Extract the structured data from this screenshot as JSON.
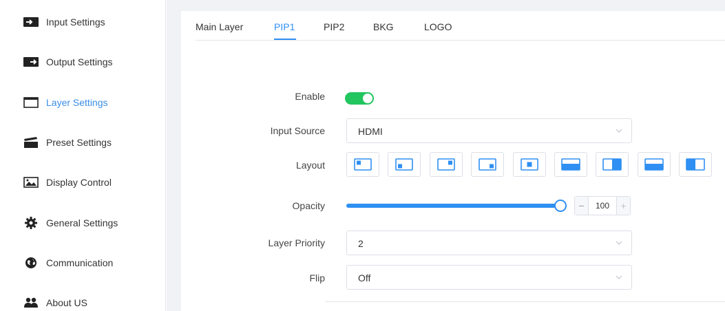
{
  "sidebar": {
    "items": [
      {
        "label": "Input Settings",
        "icon": "input-icon"
      },
      {
        "label": "Output Settings",
        "icon": "output-icon"
      },
      {
        "label": "Layer Settings",
        "icon": "window-icon",
        "active": true
      },
      {
        "label": "Preset Settings",
        "icon": "clapperboard-icon"
      },
      {
        "label": "Display Control",
        "icon": "image-icon"
      },
      {
        "label": "General Settings",
        "icon": "gear-icon"
      },
      {
        "label": "Communication",
        "icon": "globe-icon"
      },
      {
        "label": "About US",
        "icon": "users-icon"
      }
    ]
  },
  "tabs": [
    {
      "label": "Main Layer"
    },
    {
      "label": "PIP1",
      "active": true
    },
    {
      "label": "PIP2"
    },
    {
      "label": "BKG"
    },
    {
      "label": "LOGO"
    }
  ],
  "form": {
    "enable": {
      "label": "Enable",
      "value": true
    },
    "input_source": {
      "label": "Input Source",
      "value": "HDMI"
    },
    "layout": {
      "label": "Layout",
      "options": [
        "top-left",
        "bottom-left",
        "top-right",
        "bottom-right",
        "center",
        "bottom-half",
        "right-half",
        "bottom-half-alt",
        "left-half"
      ]
    },
    "opacity": {
      "label": "Opacity",
      "value": "100"
    },
    "layer_priority": {
      "label": "Layer Priority",
      "value": "2"
    },
    "flip": {
      "label": "Flip",
      "value": "Off"
    }
  },
  "colors": {
    "accent": "#2f8ff3",
    "toggle_on": "#22c55e",
    "frame": "#f0f2f5"
  }
}
